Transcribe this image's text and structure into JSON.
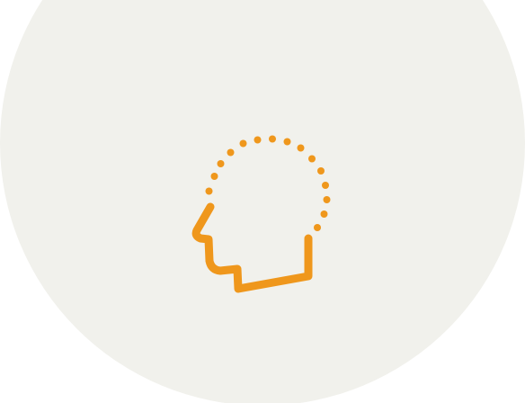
{
  "illustration": {
    "icon": "head-profile-dotted-outline-icon",
    "colors": {
      "page_background": "#ffffff",
      "circle_background": "#f1f1ec",
      "icon_stroke": "#ef971c"
    }
  }
}
